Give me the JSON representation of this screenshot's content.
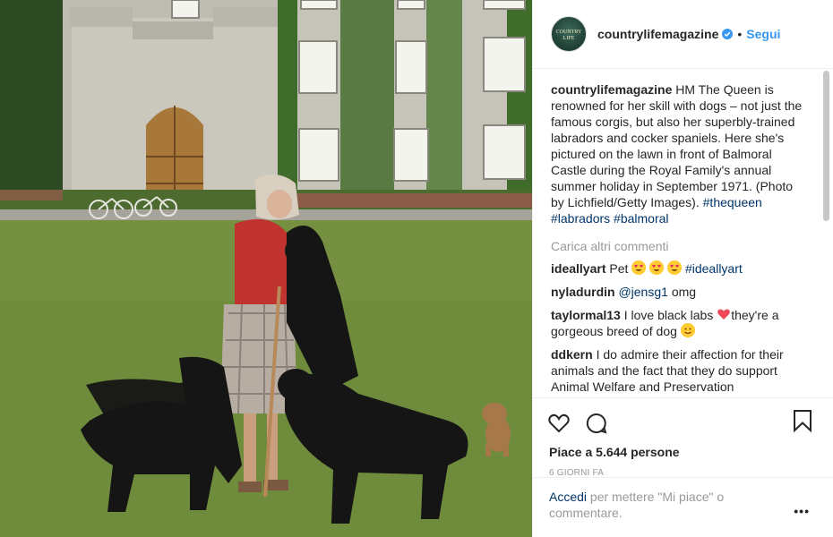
{
  "header": {
    "username": "countrylifemagazine",
    "avatar_text": "COUNTRY LIFE",
    "separator": "•",
    "follow_label": "Segui"
  },
  "caption": {
    "username": "countrylifemagazine",
    "text": "HM The Queen is renowned for her skill with dogs – not just the famous corgis, but also her superbly-trained labradors and cocker spaniels. Here she's pictured on the lawn in front of Balmoral Castle during the Royal Family's annual summer holiday in September 1971. (Photo by Lichfield/Getty Images).",
    "tags": [
      "#thequeen",
      "#labradors",
      "#balmoral"
    ]
  },
  "load_more_label": "Carica altri commenti",
  "comments": [
    {
      "username": "ideallyart",
      "text_before": "Pet",
      "tag": "#ideallyart"
    },
    {
      "username": "nyladurdin",
      "mention": "@jensg1",
      "text": "omg"
    },
    {
      "username": "taylormal13",
      "text_before": "I love black labs",
      "text_after": "they're a gorgeous breed of dog"
    },
    {
      "username": "ddkern",
      "text": "I do admire their affection for their animals and the fact that they do support Animal Welfare and Preservation"
    }
  ],
  "likes_label": "Piace a 5.644 persone",
  "time_ago": "6 GIORNI FA",
  "login": {
    "link": "Accedi",
    "text": "per mettere \"Mi piace\" o commentare."
  },
  "more_label": "•••",
  "colors": {
    "link_blue": "#3897f0",
    "hashtag": "#003569",
    "muted": "#999999",
    "heart_red": "#ed4956"
  },
  "icons": [
    "verified-icon",
    "heart-icon",
    "comment-icon",
    "bookmark-icon",
    "more-icon"
  ]
}
